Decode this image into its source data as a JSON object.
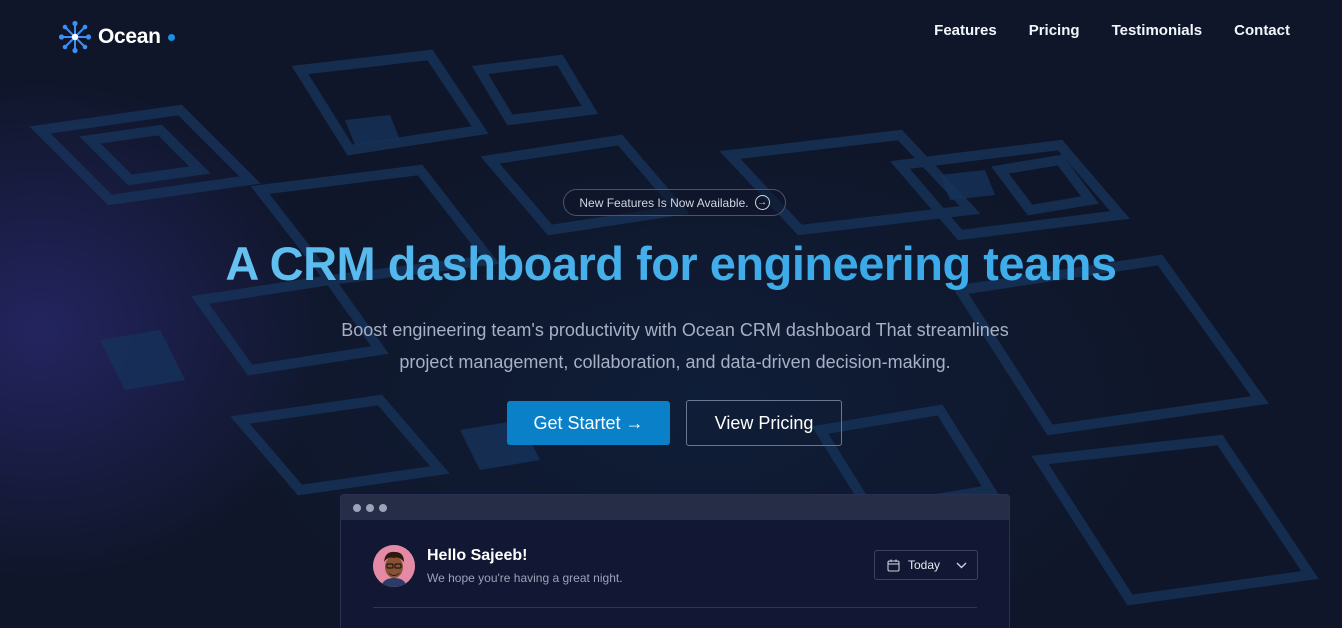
{
  "brand": {
    "name": "Ocean"
  },
  "nav": {
    "links": [
      "Features",
      "Pricing",
      "Testimonials",
      "Contact"
    ]
  },
  "hero": {
    "badge": "New Features Is Now Available.",
    "headline": "A CRM dashboard for engineering teams",
    "subtext_line1": "Boost engineering team's productivity with Ocean CRM dashboard That streamlines",
    "subtext_line2": "project management, collaboration, and data-driven decision-making.",
    "cta_primary": "Get Startet →",
    "cta_secondary": "View Pricing"
  },
  "preview": {
    "greeting": "Hello Sajeeb!",
    "subgreeting": "We hope you're having a great night.",
    "date_filter": "Today"
  },
  "colors": {
    "background": "#0f1629",
    "accent": "#0a80c9",
    "headline_gradient_start": "#7fd0f7",
    "headline_gradient_end": "#48b6ee"
  },
  "icons": [
    "ocean-logo-icon",
    "arrow-right-circle-icon",
    "calendar-icon",
    "chevron-down-icon"
  ]
}
